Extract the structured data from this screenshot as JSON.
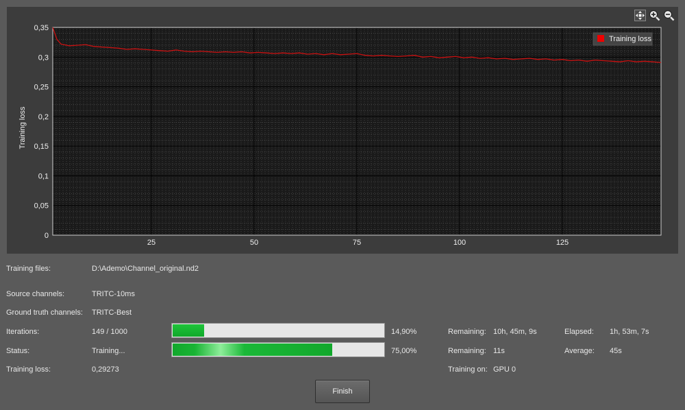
{
  "chart_toolbar": {
    "icons": [
      "fit-view-icon",
      "zoom-in-icon",
      "zoom-out-icon"
    ]
  },
  "chart_data": {
    "type": "line",
    "ylabel": "Training loss",
    "xlabel": "",
    "xlim": [
      1,
      149
    ],
    "ylim": [
      0,
      0.35
    ],
    "x_ticks": [
      25,
      50,
      75,
      100,
      125
    ],
    "x_tick_labels": [
      "25",
      "50",
      "75",
      "100",
      "125"
    ],
    "y_ticks": [
      0,
      0.05,
      0.1,
      0.15,
      0.2,
      0.25,
      0.3,
      0.35
    ],
    "y_tick_labels": [
      "0",
      "0,05",
      "0,1",
      "0,15",
      "0,2",
      "0,25",
      "0,3",
      "0,35"
    ],
    "grid": true,
    "legend_position": "top-right",
    "series": [
      {
        "name": "Training loss",
        "color": "#cc1111",
        "x": [
          1,
          2,
          3,
          5,
          7,
          9,
          11,
          13,
          15,
          17,
          19,
          21,
          23,
          25,
          27,
          29,
          31,
          33,
          35,
          37,
          39,
          41,
          43,
          45,
          47,
          49,
          51,
          53,
          55,
          57,
          59,
          61,
          63,
          65,
          67,
          69,
          71,
          73,
          75,
          77,
          79,
          81,
          83,
          85,
          87,
          89,
          91,
          93,
          95,
          97,
          99,
          101,
          103,
          105,
          107,
          109,
          111,
          113,
          115,
          117,
          119,
          121,
          123,
          125,
          127,
          129,
          131,
          133,
          135,
          137,
          139,
          141,
          143,
          145,
          147,
          149
        ],
        "y": [
          0.35,
          0.33,
          0.322,
          0.319,
          0.32,
          0.321,
          0.318,
          0.317,
          0.316,
          0.315,
          0.313,
          0.314,
          0.313,
          0.312,
          0.311,
          0.31,
          0.312,
          0.31,
          0.309,
          0.31,
          0.309,
          0.308,
          0.309,
          0.308,
          0.309,
          0.307,
          0.308,
          0.307,
          0.306,
          0.307,
          0.306,
          0.307,
          0.305,
          0.306,
          0.304,
          0.306,
          0.304,
          0.305,
          0.306,
          0.303,
          0.302,
          0.303,
          0.302,
          0.301,
          0.302,
          0.303,
          0.3,
          0.301,
          0.299,
          0.3,
          0.301,
          0.299,
          0.3,
          0.298,
          0.299,
          0.297,
          0.298,
          0.296,
          0.297,
          0.298,
          0.296,
          0.297,
          0.295,
          0.296,
          0.294,
          0.295,
          0.293,
          0.295,
          0.294,
          0.293,
          0.292,
          0.294,
          0.292,
          0.293,
          0.292,
          0.291
        ]
      }
    ]
  },
  "info": {
    "training_files_label": "Training files:",
    "training_files_value": "D:\\Ademo\\Channel_original.nd2",
    "source_channels_label": "Source channels:",
    "source_channels_value": "TRITC-10ms",
    "ground_truth_label": "Ground truth channels:",
    "ground_truth_value": "TRITC-Best",
    "iterations_label": "Iterations:",
    "iterations_value": "149 / 1000",
    "iterations_progress": 0.149,
    "iterations_percent": "14,90%",
    "iter_remaining_label": "Remaining:",
    "iter_remaining_value": "10h, 45m, 9s",
    "elapsed_label": "Elapsed:",
    "elapsed_value": "1h, 53m, 7s",
    "status_label": "Status:",
    "status_value": "Training...",
    "status_progress": 0.75,
    "status_percent": "75,00%",
    "status_remaining_label": "Remaining:",
    "status_remaining_value": "11s",
    "average_label": "Average:",
    "average_value": "45s",
    "training_loss_label": "Training loss:",
    "training_loss_value": "0,29273",
    "training_on_label": "Training on:",
    "training_on_value": "GPU 0"
  },
  "finish_label": "Finish"
}
